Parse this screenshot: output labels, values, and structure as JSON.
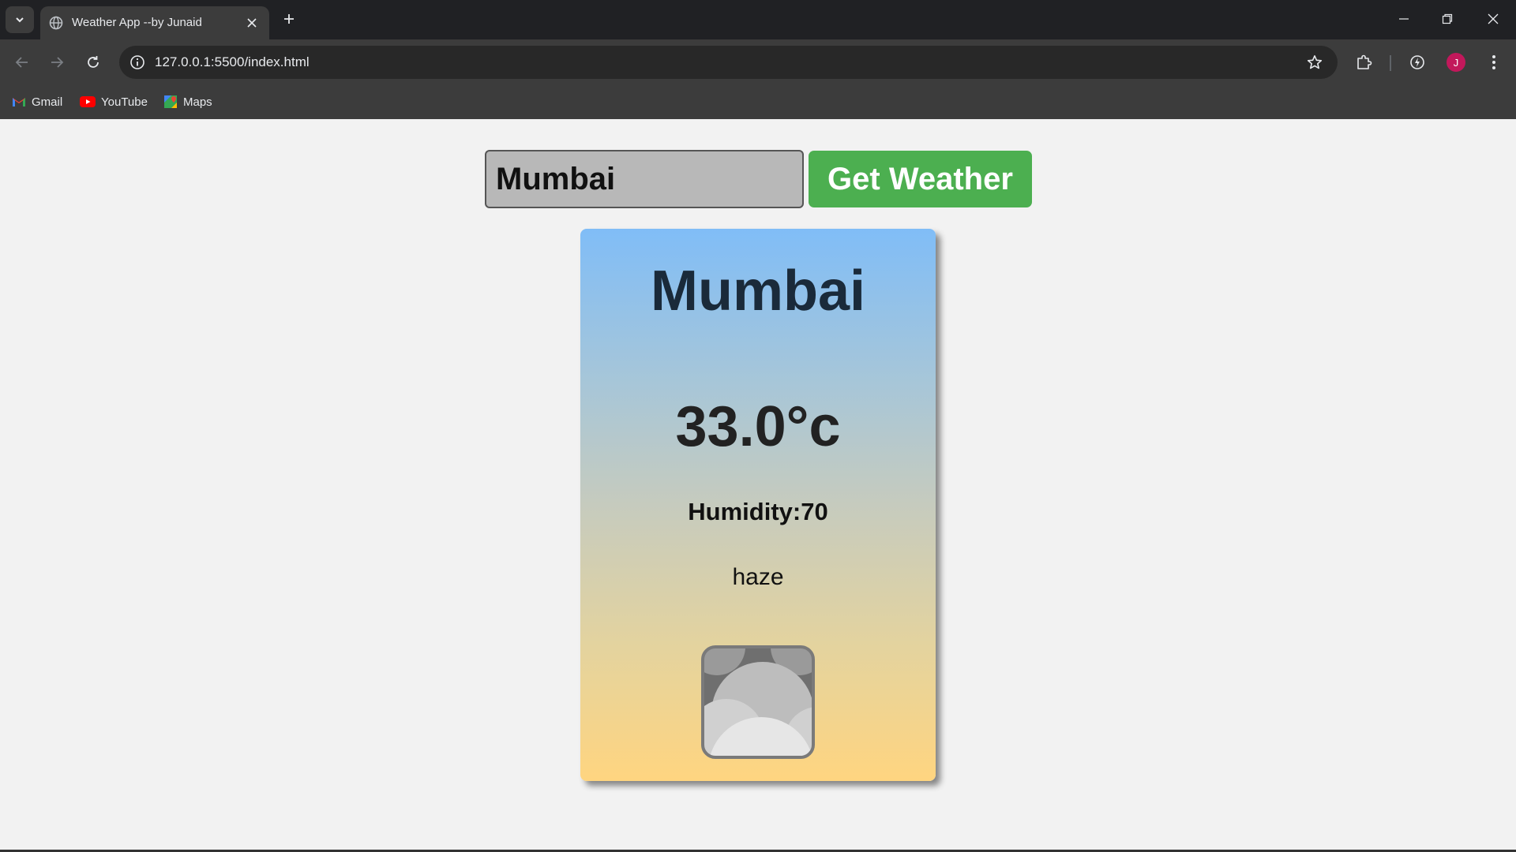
{
  "browser": {
    "tab_title": "Weather App --by Junaid",
    "url": "127.0.0.1:5500/index.html",
    "avatar_initial": "J",
    "bookmarks": [
      {
        "label": "Gmail",
        "icon": "gmail-icon"
      },
      {
        "label": "YouTube",
        "icon": "youtube-icon"
      },
      {
        "label": "Maps",
        "icon": "maps-icon"
      }
    ]
  },
  "search": {
    "value": "Mumbai",
    "button_label": "Get Weather"
  },
  "weather": {
    "city": "Mumbai",
    "temperature": "33.0°c",
    "humidity": "Humidity:70",
    "description": "haze",
    "icon": "haze-icon"
  },
  "colors": {
    "button_green": "#4caf50",
    "card_gradient_top": "#80bdf7",
    "card_gradient_bottom": "#ffd580",
    "page_background": "#f2f2f2"
  }
}
